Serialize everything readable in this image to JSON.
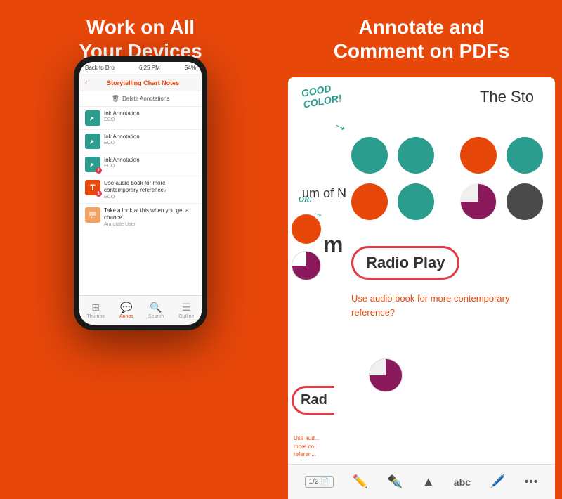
{
  "left_panel": {
    "header_line1": "Work on All",
    "header_line2": "Your Devices",
    "phone": {
      "status_bar": {
        "back_text": "Back to Dro",
        "time": "6:25 PM",
        "battery": "54%"
      },
      "nav": {
        "back": "‹",
        "title": "Storytelling Chart Notes"
      },
      "delete_bar": "Delete Annotations",
      "annotations": [
        {
          "type": "teal",
          "title": "Ink Annotation",
          "sub": "ECO",
          "badge": null
        },
        {
          "type": "teal",
          "title": "Ink Annotation",
          "sub": "ECO",
          "badge": null
        },
        {
          "type": "teal",
          "title": "Ink Annotation",
          "sub": "ECO",
          "badge": "1"
        },
        {
          "type": "red-T",
          "title": "Use audio book for more contemporary reference?",
          "sub": "ECO",
          "badge": "1"
        },
        {
          "type": "yellow",
          "title": "Take a look at this when you get a chance.",
          "sub": "Annotate User",
          "badge": null
        }
      ],
      "tabs": [
        "Thumbs",
        "Annos",
        "Search",
        "Outline"
      ]
    }
  },
  "right_panel": {
    "header_line1": "Annotate and",
    "header_line2": "Comment on PDFs",
    "pdf": {
      "handwriting": "GOOD\nCOLOR!",
      "title_partial": "The Sto",
      "circles": [
        {
          "color": "teal",
          "label": "teal circle"
        },
        {
          "color": "dark-gray",
          "label": "dark gray circle"
        },
        {
          "color": "orange",
          "label": "orange circle"
        },
        {
          "color": "teal",
          "label": "teal circle 2"
        },
        {
          "color": "dark-gray",
          "label": "dark gray circle 2"
        },
        {
          "color": "pie-purple",
          "label": "purple pie circle"
        },
        {
          "color": "dark-gray",
          "label": "dark gray circle 3"
        },
        {
          "color": "pie-dark",
          "label": "dark pie circle"
        }
      ],
      "radio_play_label": "Radio Play",
      "audio_book_text": "Use audio book for more contemporary reference?",
      "toolbar_items": [
        "1/2",
        "✎",
        "✎",
        "▲",
        "abc",
        "✒",
        "•••"
      ]
    }
  }
}
